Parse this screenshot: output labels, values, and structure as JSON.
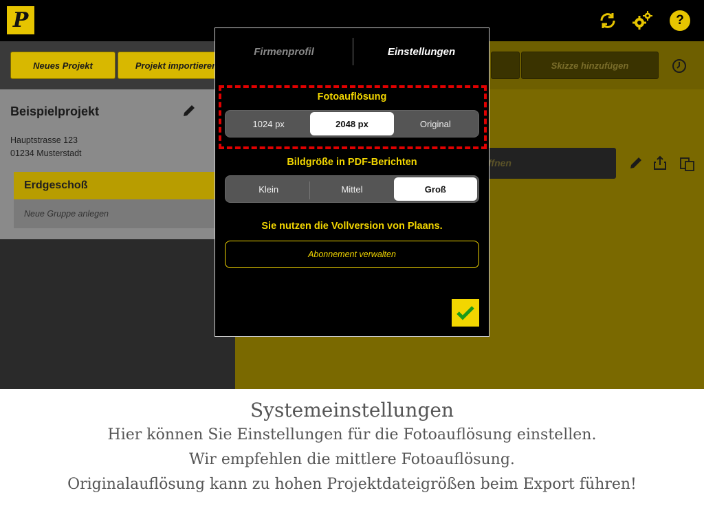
{
  "app": {
    "logo_letter": "P",
    "toolbar": {
      "new_project": "Neues Projekt",
      "import_project": "Projekt importieren",
      "add_sketch": "Skizze hinzufügen",
      "open_partial": "ffnen"
    },
    "project": {
      "name": "Beispielprojekt",
      "street": "Hauptstrasse 123",
      "city": "01234 Musterstadt",
      "floor": "Erdgeschoß",
      "new_group": "Neue Gruppe anlegen"
    },
    "colors": {
      "accent": "#f2d600",
      "highlight": "#e00000"
    }
  },
  "modal": {
    "tabs": [
      {
        "label": "Firmenprofil",
        "active": false
      },
      {
        "label": "Einstellungen",
        "active": true
      }
    ],
    "photo_resolution": {
      "label": "Fotoauflösung",
      "options": [
        "1024 px",
        "2048 px",
        "Original"
      ],
      "selected": "2048 px"
    },
    "pdf_image_size": {
      "label": "Bildgröße in PDF-Berichten",
      "options": [
        "Klein",
        "Mittel",
        "Groß"
      ],
      "selected": "Groß"
    },
    "full_version_note": "Sie nutzen die Vollversion von Plaans.",
    "subscription_button": "Abonnement verwalten"
  },
  "caption": {
    "title": "Systemeinstellungen",
    "lines": [
      "Hier können Sie Einstellungen für die Fotoauflösung einstellen.",
      "Wir empfehlen die mittlere Fotoauflösung.",
      "Originalauflösung kann zu hohen Projektdateigrößen beim Export führen!"
    ]
  }
}
